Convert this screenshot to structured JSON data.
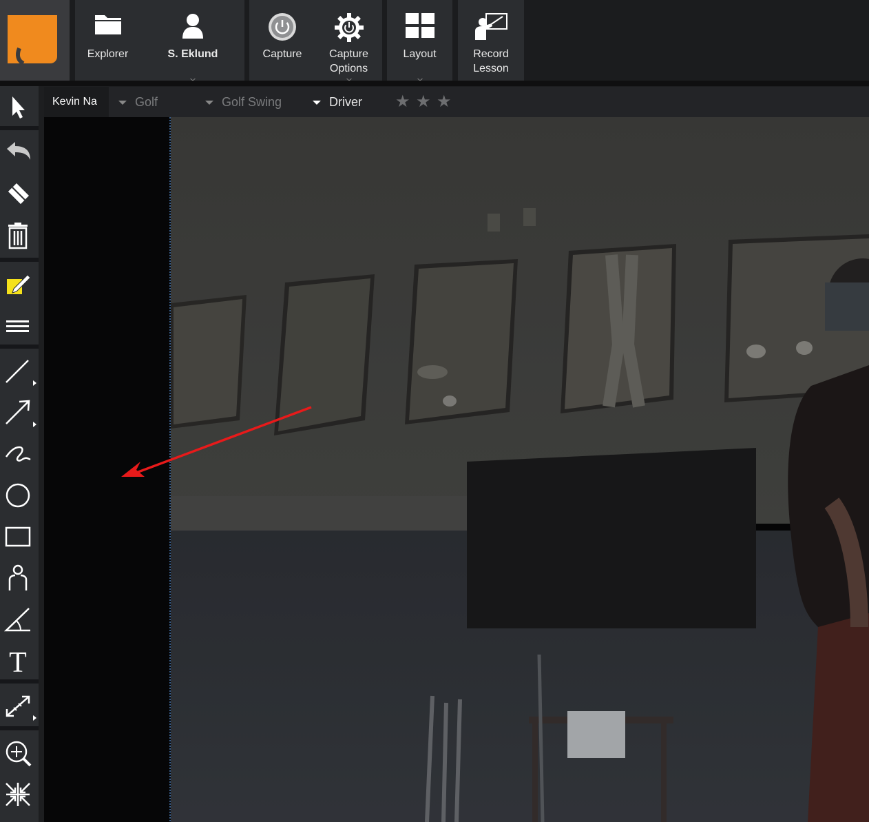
{
  "toolbar": {
    "explorer": "Explorer",
    "user": "S. Eklund",
    "capture": "Capture",
    "capture_options_line1": "Capture",
    "capture_options_line2": "Options",
    "layout": "Layout",
    "record_line1": "Record",
    "record_line2": "Lesson"
  },
  "tags": {
    "athlete": "Kevin Na",
    "sport": "Golf",
    "category": "Golf Swing",
    "club": "Driver"
  },
  "rating": {
    "max": 3,
    "value": 0
  },
  "colors": {
    "logo": "#f08a1e",
    "annotation_arrow": "#e81a1a",
    "pen_highlight": "#f5e11b",
    "toolbar_bg": "#2b2d30"
  },
  "tools": [
    "select-tool",
    "undo-tool",
    "eraser-tool",
    "delete-tool",
    "pen-color-tool",
    "line-style-tool",
    "line-tool",
    "arrow-tool",
    "freehand-tool",
    "circle-tool",
    "rectangle-tool",
    "body-angle-tool",
    "angle-tool",
    "text-tool",
    "measure-tool",
    "zoom-tool",
    "fit-tool"
  ]
}
